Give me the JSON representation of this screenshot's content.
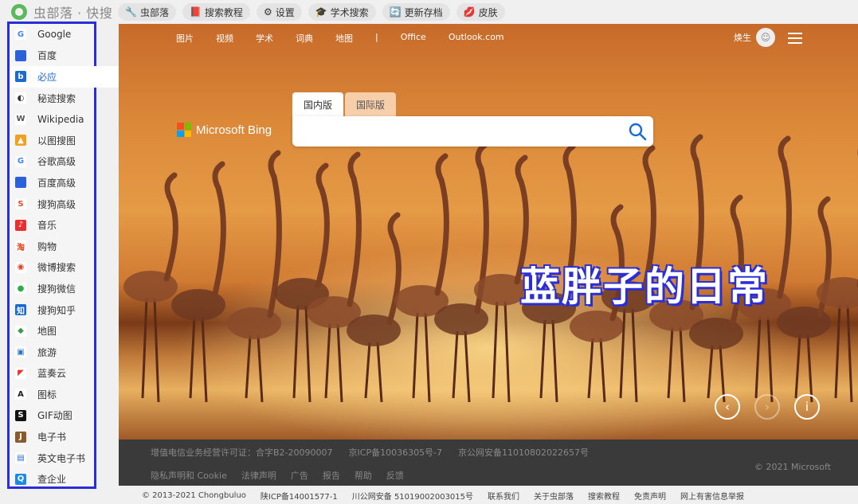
{
  "topbar": {
    "logo_text": "虫部落 · 快搜",
    "items": [
      {
        "label": "虫部落",
        "icon": "🔧"
      },
      {
        "label": "搜索教程",
        "icon": "📕"
      },
      {
        "label": "设置",
        "icon": "⚙"
      },
      {
        "label": "学术搜索",
        "icon": "🎓"
      },
      {
        "label": "更新存档",
        "icon": "🔄"
      },
      {
        "label": "皮肤",
        "icon": "💋"
      }
    ]
  },
  "sidebar": {
    "items": [
      {
        "label": "Google",
        "icon": "G",
        "color": "#ffffff",
        "fg": "#4285f4"
      },
      {
        "label": "百度",
        "icon": "🐾",
        "color": "#2f5fe0",
        "fg": "#ffffff"
      },
      {
        "label": "必应",
        "icon": "b",
        "color": "#1a6bd1",
        "fg": "#ffffff",
        "active": true
      },
      {
        "label": "秘迹搜索",
        "icon": "◐",
        "color": "#ffffff",
        "fg": "#333333"
      },
      {
        "label": "Wikipedia",
        "icon": "W",
        "color": "#ffffff",
        "fg": "#555555"
      },
      {
        "label": "以图搜图",
        "icon": "▲",
        "color": "#f0a020",
        "fg": "#ffffff"
      },
      {
        "label": "谷歌高级",
        "icon": "G",
        "color": "#ffffff",
        "fg": "#4285f4"
      },
      {
        "label": "百度高级",
        "icon": "🐾",
        "color": "#2f5fe0",
        "fg": "#ffffff"
      },
      {
        "label": "搜狗高级",
        "icon": "S",
        "color": "#ffffff",
        "fg": "#e84a2a"
      },
      {
        "label": "音乐",
        "icon": "♪",
        "color": "#e83030",
        "fg": "#ffffff"
      },
      {
        "label": "购物",
        "icon": "淘",
        "color": "#ffffff",
        "fg": "#e8401c"
      },
      {
        "label": "微博搜索",
        "icon": "◉",
        "color": "#ffffff",
        "fg": "#e8401c"
      },
      {
        "label": "搜狗微信",
        "icon": "●",
        "color": "#ffffff",
        "fg": "#2bae44"
      },
      {
        "label": "搜狗知乎",
        "icon": "知",
        "color": "#1a6bd1",
        "fg": "#ffffff"
      },
      {
        "label": "地图",
        "icon": "◆",
        "color": "#ffffff",
        "fg": "#3a9a4a"
      },
      {
        "label": "旅游",
        "icon": "▣",
        "color": "#ffffff",
        "fg": "#2a7ac8"
      },
      {
        "label": "蓝奏云",
        "icon": "◤",
        "color": "#ffffff",
        "fg": "#e83030"
      },
      {
        "label": "图标",
        "icon": "A",
        "color": "#ffffff",
        "fg": "#222222"
      },
      {
        "label": "GIF动图",
        "icon": "S",
        "color": "#111111",
        "fg": "#ffffff"
      },
      {
        "label": "电子书",
        "icon": "J",
        "color": "#8b5a2b",
        "fg": "#ffffff"
      },
      {
        "label": "英文电子书",
        "icon": "▤",
        "color": "#ffffff",
        "fg": "#2a6ad1"
      },
      {
        "label": "查企业",
        "icon": "Q",
        "color": "#1a8ae8",
        "fg": "#ffffff"
      }
    ]
  },
  "bing": {
    "nav": [
      "图片",
      "视频",
      "学术",
      "词典",
      "地图",
      "|",
      "Office",
      "Outlook.com"
    ],
    "user_name": "焕生",
    "logo_text": "Microsoft Bing",
    "tabs": [
      "国内版",
      "国际版"
    ],
    "search_placeholder": "",
    "overlay_title": "蓝胖子的日常",
    "footer_row1": [
      "增值电信业务经营许可证：合字B2-20090007",
      "京ICP备10036305号-7",
      "京公网安备11010802022657号"
    ],
    "footer_row2": [
      "隐私声明和 Cookie",
      "法律声明",
      "广告",
      "报告",
      "帮助",
      "反馈"
    ],
    "footer_copyright": "© 2021 Microsoft"
  },
  "page_footer": [
    "© 2013-2021 Chongbuluo",
    "陕ICP备14001577-1",
    "川公网安备 51019002003015号",
    "联系我们",
    "关于虫部落",
    "搜索教程",
    "免责声明",
    "网上有害信息举报"
  ],
  "colors": {
    "sidebar_border": "#2a2ed9",
    "accent": "#1a6bd1"
  }
}
